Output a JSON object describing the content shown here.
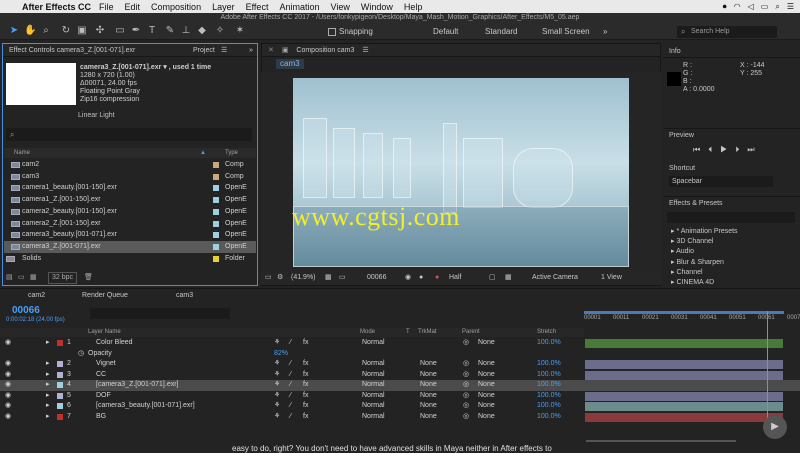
{
  "menubar": {
    "app": "After Effects CC",
    "items": [
      "File",
      "Edit",
      "Composition",
      "Layer",
      "Effect",
      "Animation",
      "View",
      "Window",
      "Help"
    ],
    "clock": "⏺"
  },
  "window_title": "Adobe After Effects CC 2017 - /Users/fonkypigeon/Desktop/Maya_Mash_Motion_Graphics/After_Effects/M5_05.aep",
  "toolbar": {
    "snapping": "Snapping",
    "workspaces": [
      "Default",
      "Standard",
      "Small Screen"
    ],
    "search_placeholder": "Search Help"
  },
  "project": {
    "tab_effect": "Effect Controls camera3_Z.[001-071].exr",
    "tab_project": "Project",
    "info": {
      "name": "camera3_Z.[001-071].exr ▾ , used 1 time",
      "dims": "1280 x 720 (1.00)",
      "dur": "Δ00071, 24.00 fps",
      "depth": "Floating Point Gray",
      "comp": "Zip16 compression"
    },
    "linear": "Linear Light",
    "col_name": "Name",
    "col_type": "Type",
    "rows": [
      {
        "name": "cam2",
        "type": "Comp",
        "color": "#c8a878",
        "icon": "comp"
      },
      {
        "name": "cam3",
        "type": "Comp",
        "color": "#c8a878",
        "icon": "comp"
      },
      {
        "name": "camera1_beauty.[001-150].exr",
        "type": "OpenE",
        "color": "#9fd0e0",
        "icon": "seq"
      },
      {
        "name": "camera1_Z.[001-150].exr",
        "type": "OpenE",
        "color": "#9fd0e0",
        "icon": "seq"
      },
      {
        "name": "camera2_beauty.[001-150].exr",
        "type": "OpenE",
        "color": "#9fd0e0",
        "icon": "seq"
      },
      {
        "name": "camera2_Z.[001-150].exr",
        "type": "OpenE",
        "color": "#9fd0e0",
        "icon": "seq"
      },
      {
        "name": "camera3_beauty.[001-071].exr",
        "type": "OpenE",
        "color": "#9fd0e0",
        "icon": "seq"
      },
      {
        "name": "camera3_Z.[001-071].exr",
        "type": "OpenE",
        "color": "#9fd0e0",
        "icon": "seq",
        "selected": true
      },
      {
        "name": "Solids",
        "type": "Folder",
        "color": "#e6d22c",
        "icon": "folder"
      }
    ],
    "bpc": "32 bpc"
  },
  "composition": {
    "tab": "Composition cam3",
    "subtab": "cam3",
    "zoom": "(41.9%)",
    "frame": "00066",
    "res": "Half",
    "camera": "Active Camera",
    "views": "1 View"
  },
  "watermark": "www.cgtsj.com",
  "info_panel": {
    "title": "Info",
    "r": "R :",
    "g": "G :",
    "b": "B :",
    "a": "A : 0.0000",
    "x": "X : -144",
    "y": "Y : 255"
  },
  "preview": {
    "title": "Preview",
    "shortcut": "Shortcut",
    "shortcut_val": "Spacebar"
  },
  "effects": {
    "title": "Effects & Presets",
    "items": [
      "* Animation Presets",
      "3D Channel",
      "Audio",
      "Blur & Sharpen",
      "Channel",
      "CINEMA 4D"
    ]
  },
  "timeline": {
    "tabs": [
      "cam2",
      "Render Queue",
      "cam3"
    ],
    "timecode": "00066",
    "timecode_sub": "0:00:02:18 (24.00 fps)",
    "cols": {
      "layer": "Layer Name",
      "mode": "Mode",
      "t": "T",
      "trkmat": "TrkMat",
      "parent": "Parent",
      "stretch": "Stretch"
    },
    "ruler": [
      "00001",
      "00011",
      "00021",
      "00031",
      "00041",
      "00051",
      "00061",
      "0007"
    ],
    "layers": [
      {
        "num": "1",
        "name": "Color Bleed",
        "mode": "Normal",
        "trk": "",
        "parent": "None",
        "stretch": "100.0%",
        "color": "#c03030",
        "bar": "#4a7a3a"
      },
      {
        "num": "",
        "name": "Opacity",
        "mode": "",
        "trk": "",
        "parent": "",
        "stretch": "",
        "color": "",
        "bar": "",
        "prop": "82%"
      },
      {
        "num": "2",
        "name": "Vignet",
        "mode": "Normal",
        "trk": "None",
        "parent": "None",
        "stretch": "100.0%",
        "color": "#b0b0d0",
        "bar": "#6c6c8c"
      },
      {
        "num": "3",
        "name": "CC",
        "mode": "Normal",
        "trk": "None",
        "parent": "None",
        "stretch": "100.0%",
        "color": "#b0b0d0",
        "bar": "#6c6c8c"
      },
      {
        "num": "4",
        "name": "[camera3_Z.[001-071].exr]",
        "mode": "Normal",
        "trk": "None",
        "parent": "None",
        "stretch": "100.0%",
        "color": "#9fd0e0",
        "bar": "#8ab8b8",
        "selected": true
      },
      {
        "num": "5",
        "name": "DOF",
        "mode": "Normal",
        "trk": "None",
        "parent": "None",
        "stretch": "100.0%",
        "color": "#b0b0d0",
        "bar": "#6c6c8c"
      },
      {
        "num": "6",
        "name": "[camera3_beauty.[001-071].exr]",
        "mode": "Normal",
        "trk": "None",
        "parent": "None",
        "stretch": "100.0%",
        "color": "#9fd0e0",
        "bar": "#6c8c8c"
      },
      {
        "num": "7",
        "name": "BG",
        "mode": "Normal",
        "trk": "None",
        "parent": "None",
        "stretch": "100.0%",
        "color": "#c03030",
        "bar": "#8a3a3a"
      }
    ]
  },
  "caption": "easy to do, right? You don't need to have advanced skills in Maya neither in After effects to"
}
